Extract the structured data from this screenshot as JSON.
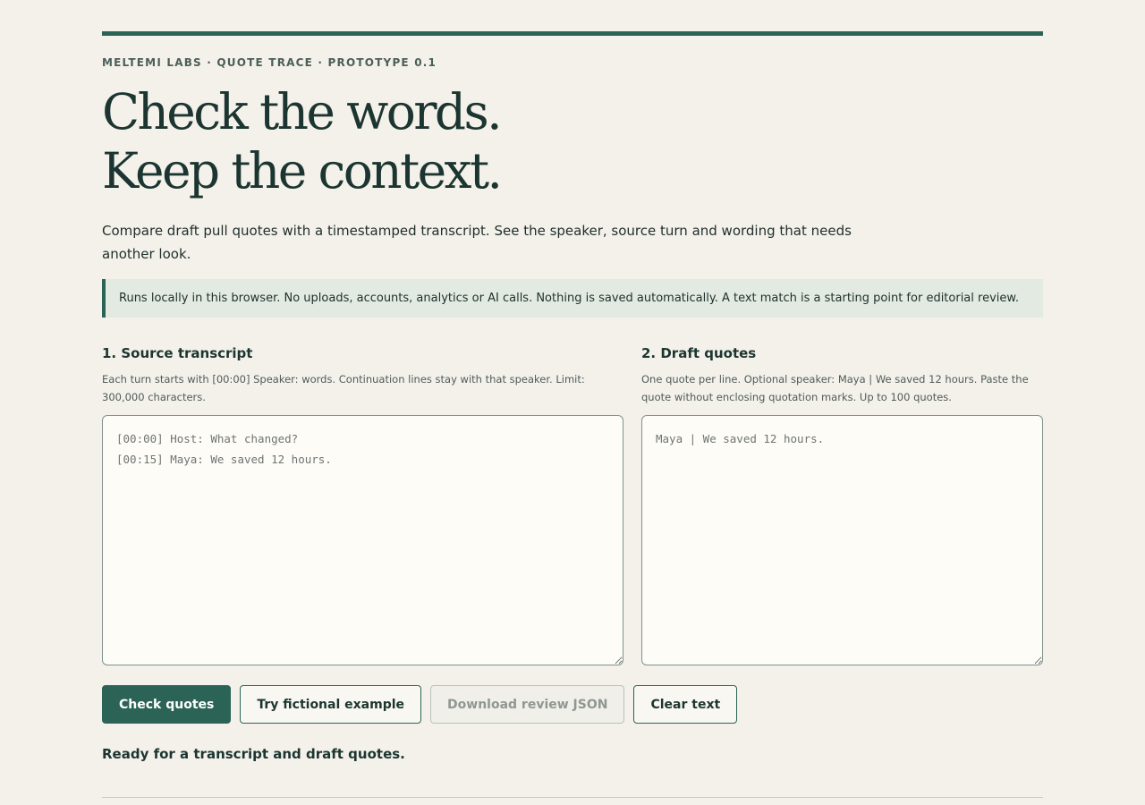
{
  "header": {
    "eyebrow": "MELTEMI LABS · QUOTE TRACE · PROTOTYPE 0.1",
    "headline_line1": "Check the words.",
    "headline_line2": "Keep the context.",
    "lede": "Compare draft pull quotes with a timestamped transcript. See the speaker, source turn and wording that needs another look."
  },
  "notice": "Runs locally in this browser. No uploads, accounts, analytics or AI calls. Nothing is saved automatically. A text match is a starting point for editorial review.",
  "source": {
    "title": "1. Source transcript",
    "help": "Each turn starts with [00:00] Speaker: words. Continuation lines stay with that speaker. Limit: 300,000 characters.",
    "value": "",
    "placeholder": "[00:00] Host: What changed?\n[00:15] Maya: We saved 12 hours."
  },
  "quotes": {
    "title": "2. Draft quotes",
    "help": "One quote per line. Optional speaker: Maya | We saved 12 hours. Paste the quote without enclosing quotation marks. Up to 100 quotes.",
    "value": "",
    "placeholder": "Maya | We saved 12 hours."
  },
  "actions": {
    "check": "Check quotes",
    "example": "Try fictional example",
    "download": "Download review JSON",
    "clear": "Clear text"
  },
  "status": "Ready for a transcript and draft quotes.",
  "colors": {
    "accent": "#2b6456",
    "background": "#f4f1eb",
    "notice_bg": "#e2eae1",
    "ink": "#1c3530"
  }
}
